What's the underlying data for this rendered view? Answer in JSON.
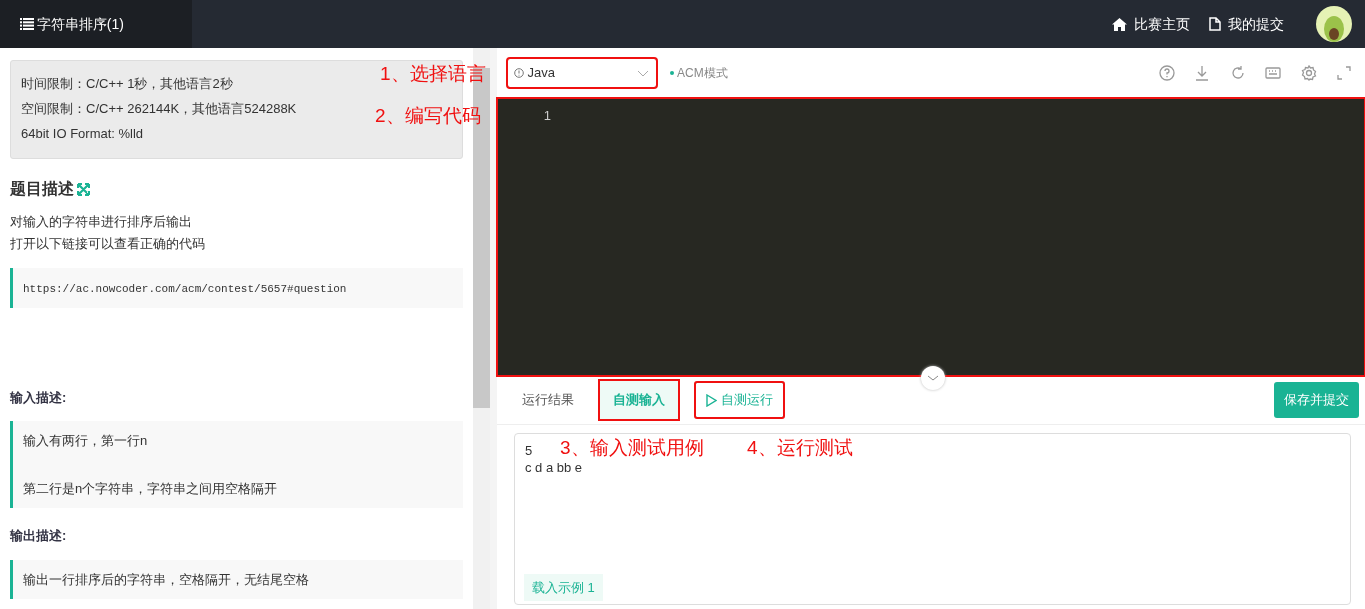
{
  "header": {
    "title": "字符串排序(1)",
    "links": [
      {
        "label": "比赛主页"
      },
      {
        "label": "我的提交"
      }
    ]
  },
  "limits": [
    "时间限制：C/C++ 1秒，其他语言2秒",
    "空间限制：C/C++ 262144K，其他语言524288K",
    "64bit IO Format: %lld"
  ],
  "description": {
    "heading": "题目描述",
    "lines": [
      "对输入的字符串进行排序后输出",
      "打开以下链接可以查看正确的代码"
    ],
    "code": "https://ac.nowcoder.com/acm/contest/5657#question"
  },
  "input_desc": {
    "heading": "输入描述:",
    "paragraphs": [
      "输入有两行，第一行n",
      "第二行是n个字符串，字符串之间用空格隔开"
    ]
  },
  "output_desc": {
    "heading": "输出描述:",
    "paragraphs": [
      "输出一行排序后的字符串，空格隔开，无结尾空格"
    ]
  },
  "language_select": {
    "value": "Java",
    "highlighted": true
  },
  "mode": "ACM模式",
  "editor": {
    "line_numbers": [
      "1"
    ],
    "highlighted": true
  },
  "tabs": [
    {
      "label": "运行结果",
      "selected": false,
      "highlighted": false
    },
    {
      "label": "自测输入",
      "selected": true,
      "highlighted": true
    }
  ],
  "run_button": {
    "label": "自测运行",
    "highlighted": true
  },
  "submit_button": {
    "label": "保存并提交"
  },
  "test_input": {
    "value": "5\nc d a bb e",
    "load_sample": "载入示例 1"
  },
  "annotations": [
    {
      "text": "1、选择语言"
    },
    {
      "text": "2、编写代码"
    },
    {
      "text": "3、输入测试用例"
    },
    {
      "text": "4、运行测试"
    }
  ]
}
